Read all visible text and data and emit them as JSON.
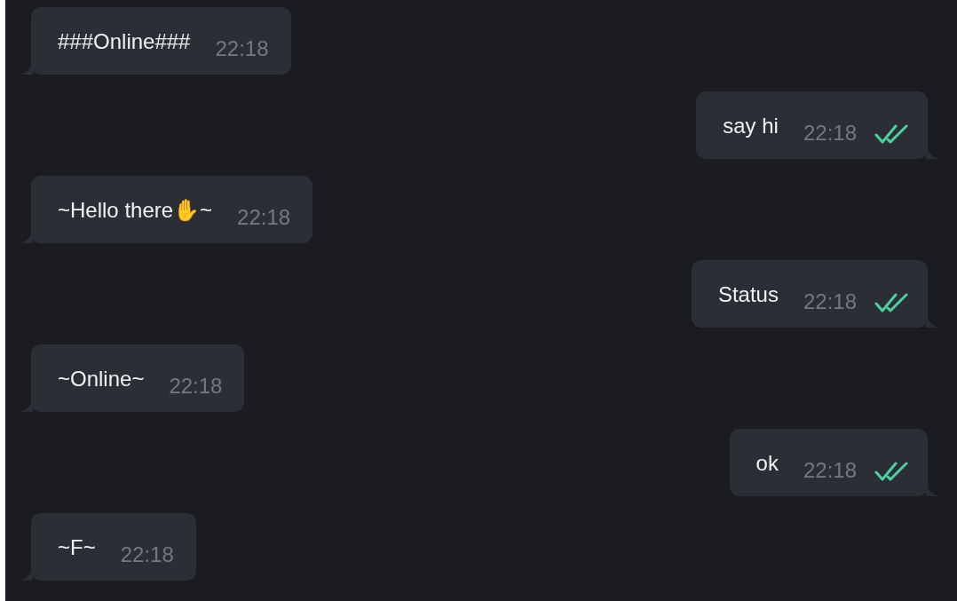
{
  "messages": [
    {
      "kind": "incoming",
      "text": "###Online###",
      "time": "22:18"
    },
    {
      "kind": "outgoing",
      "text": "say hi",
      "time": "22:18",
      "read": true
    },
    {
      "kind": "incoming",
      "text": "~Hello there✋~",
      "time": "22:18"
    },
    {
      "kind": "outgoing",
      "text": "Status",
      "time": "22:18",
      "read": true
    },
    {
      "kind": "incoming",
      "text": "~Online~",
      "time": "22:18"
    },
    {
      "kind": "outgoing",
      "text": "ok",
      "time": "22:18",
      "read": true
    },
    {
      "kind": "incoming",
      "text": "~F~",
      "time": "22:18"
    }
  ]
}
